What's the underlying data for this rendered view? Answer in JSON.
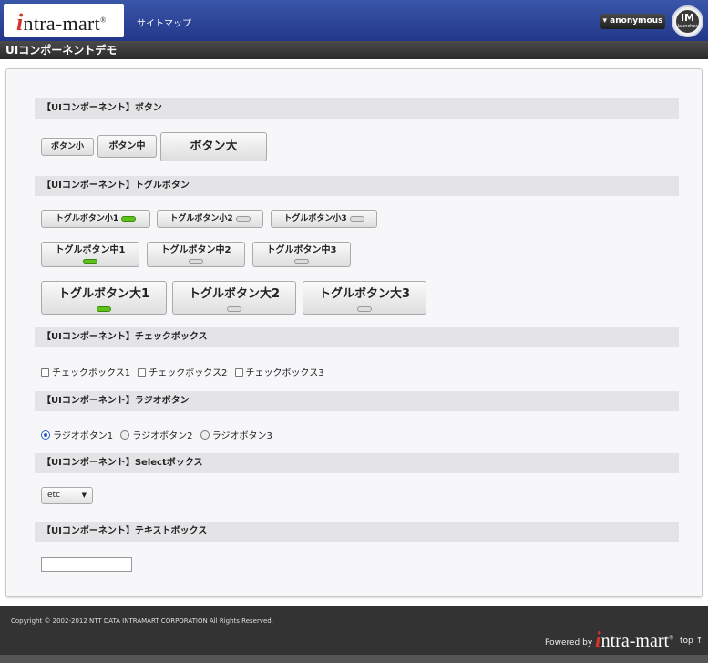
{
  "header": {
    "logo_mark": "i",
    "logo_text": "ntra-mart",
    "logo_reg": "®",
    "sitemap_label": "サイトマップ",
    "user_label": "▾ anonymous",
    "launcher_top": "IM",
    "launcher_bottom": "launcher"
  },
  "page_title": "UIコンポーネントデモ",
  "sections": {
    "button": "【UIコンポーネント】ボタン",
    "toggle": "【UIコンポーネント】トグルボタン",
    "checkbox": "【UIコンポーネント】チェックボックス",
    "radio": "【UIコンポーネント】ラジオボタン",
    "select": "【UIコンポーネント】Selectボックス",
    "textbox": "【UIコンポーネント】テキストボックス"
  },
  "buttons": {
    "small": "ボタン小",
    "medium": "ボタン中",
    "large": "ボタン大"
  },
  "toggles": {
    "small": [
      {
        "label": "トグルボタン小1",
        "on": true
      },
      {
        "label": "トグルボタン小2",
        "on": false
      },
      {
        "label": "トグルボタン小3",
        "on": false
      }
    ],
    "medium": [
      {
        "label": "トグルボタン中1",
        "on": true
      },
      {
        "label": "トグルボタン中2",
        "on": false
      },
      {
        "label": "トグルボタン中3",
        "on": false
      }
    ],
    "large": [
      {
        "label": "トグルボタン大1",
        "on": true
      },
      {
        "label": "トグルボタン大2",
        "on": false
      },
      {
        "label": "トグルボタン大3",
        "on": false
      }
    ]
  },
  "checkboxes": [
    {
      "label": "チェックボックス1",
      "checked": false
    },
    {
      "label": "チェックボックス2",
      "checked": false
    },
    {
      "label": "チェックボックス3",
      "checked": false
    }
  ],
  "radios": [
    {
      "label": "ラジオボタン1",
      "selected": true
    },
    {
      "label": "ラジオボタン2",
      "selected": false
    },
    {
      "label": "ラジオボタン3",
      "selected": false
    }
  ],
  "select": {
    "value": "etc",
    "arrow": "▼"
  },
  "textbox": {
    "value": ""
  },
  "footer": {
    "copyright": "Copyright © 2002-2012 NTT DATA INTRAMART CORPORATION All Rights Reserved.",
    "powered_by": "Powered by",
    "logo_mark": "i",
    "logo_text": "ntra-mart",
    "logo_reg": "®",
    "top_link": "top ↑"
  }
}
